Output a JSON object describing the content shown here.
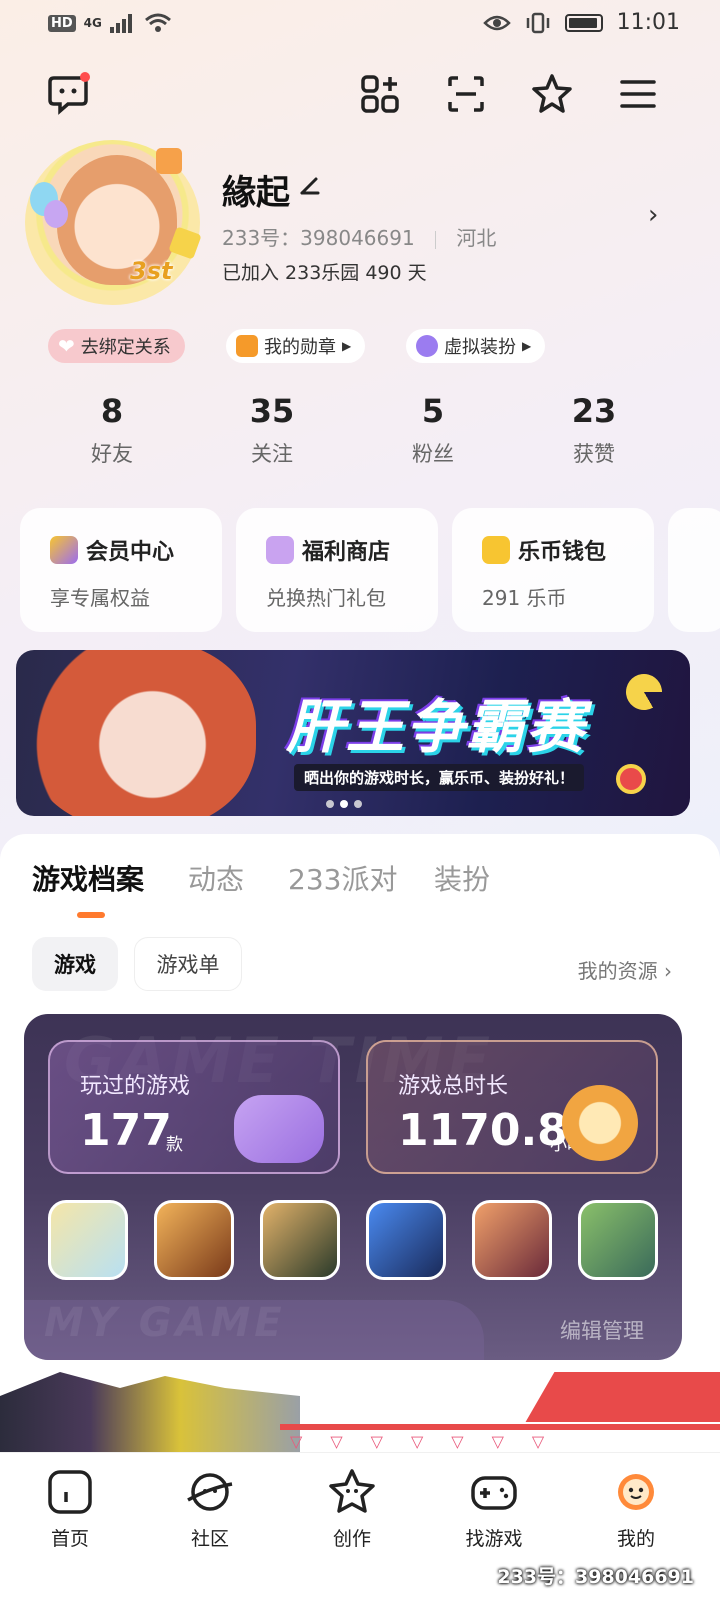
{
  "status_bar": {
    "network_badge": "HD",
    "signal": "4G",
    "time": "11:01"
  },
  "toolbar": {
    "icons": [
      "chat-icon",
      "add-app-icon",
      "scan-icon",
      "star-icon",
      "menu-icon"
    ]
  },
  "profile": {
    "username": "緣起",
    "uid_label": "233号：398046691",
    "location": "河北",
    "joined_text": "已加入 233乐园 490 天",
    "avatar_badge": "3st"
  },
  "tags": [
    {
      "label": "去绑定关系",
      "icon": "heart-icon"
    },
    {
      "label": "我的勋章",
      "icon": "medal-icon"
    },
    {
      "label": "虚拟装扮",
      "icon": "avatar-dress-icon"
    }
  ],
  "stats": [
    {
      "value": "8",
      "label": "好友"
    },
    {
      "value": "35",
      "label": "关注"
    },
    {
      "value": "5",
      "label": "粉丝"
    },
    {
      "value": "23",
      "label": "获赞"
    }
  ],
  "features": [
    {
      "title": "会员中心",
      "subtitle": "享专属权益",
      "color": "#9b6cf0"
    },
    {
      "title": "福利商店",
      "subtitle": "兑换热门礼包",
      "color": "#c9a3f0"
    },
    {
      "title": "乐币钱包",
      "subtitle": "291 乐币",
      "color": "#f7c531"
    }
  ],
  "banner": {
    "title": "肝王争霸赛",
    "subtitle": "晒出你的游戏时长，赢乐币、装扮好礼！"
  },
  "tabs": [
    {
      "label": "游戏档案",
      "active": true
    },
    {
      "label": "动态",
      "active": false
    },
    {
      "label": "233派对",
      "active": false
    },
    {
      "label": "装扮",
      "active": false
    }
  ],
  "subtabs": [
    {
      "label": "游戏",
      "active": true
    },
    {
      "label": "游戏单",
      "active": false
    }
  ],
  "my_resources": "我的资源",
  "archive": {
    "bg_top": "GAME TIME",
    "bg_bottom": "MY GAME",
    "played_label": "玩过的游戏",
    "played_value": "177",
    "played_unit": "款",
    "time_label": "游戏总时长",
    "time_value": "1170.8",
    "time_unit": "小时",
    "edit_label": "编辑管理",
    "game_icons": [
      "#f5e6a8",
      "#d38a3a",
      "#7a8a4a",
      "#3a6ad0",
      "#c0503a",
      "#6aa05a"
    ]
  },
  "bottom_nav": [
    {
      "label": "首页",
      "icon": "home-icon"
    },
    {
      "label": "社区",
      "icon": "planet-icon"
    },
    {
      "label": "创作",
      "icon": "star-face-icon"
    },
    {
      "label": "找游戏",
      "icon": "gamepad-icon"
    },
    {
      "label": "我的",
      "icon": "smiley-icon"
    }
  ],
  "watermark": "233号：398046691",
  "accent_color": "#ff7a2e"
}
